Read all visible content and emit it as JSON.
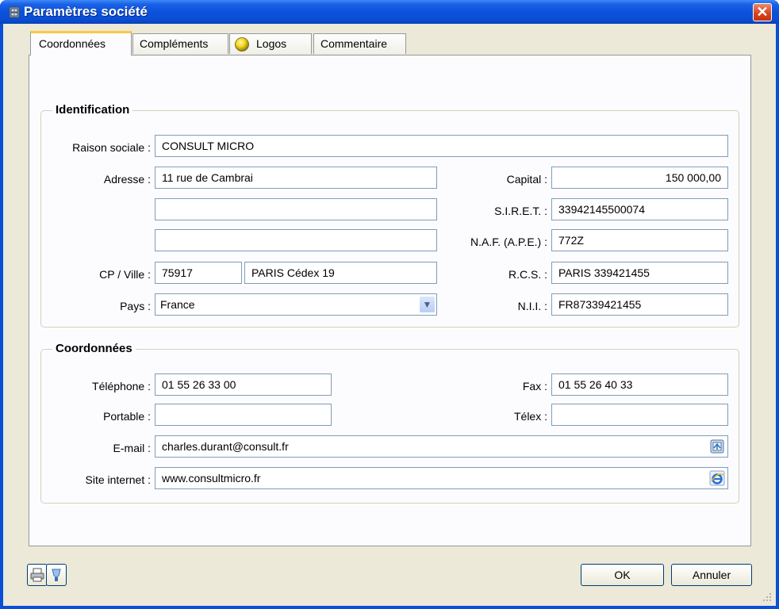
{
  "window": {
    "title": "Paramètres société",
    "icon": "app-cabinet-icon",
    "close_icon": "close-icon"
  },
  "tabs": [
    {
      "label": "Coordonnées",
      "active": true
    },
    {
      "label": "Compléments",
      "active": false
    },
    {
      "label": "Logos",
      "icon": "logo-sphere-icon",
      "active": false
    },
    {
      "label": "Commentaire",
      "active": false
    }
  ],
  "identification": {
    "title": "Identification",
    "raison_sociale": {
      "label": "Raison sociale :",
      "value": "CONSULT MICRO"
    },
    "adresse": {
      "label": "Adresse :",
      "line1": "11 rue de Cambrai",
      "line2": "",
      "line3": ""
    },
    "cp_ville": {
      "label": "CP / Ville :",
      "cp": "75917",
      "ville": "PARIS Cédex 19"
    },
    "pays": {
      "label": "Pays :",
      "value": "France",
      "icon": "chevron-down-icon"
    },
    "capital": {
      "label": "Capital :",
      "value": "150 000,00"
    },
    "siret": {
      "label": "S.I.R.E.T. :",
      "value": "33942145500074"
    },
    "naf": {
      "label": "N.A.F. (A.P.E.) :",
      "value": "772Z"
    },
    "rcs": {
      "label": "R.C.S. :",
      "value": "PARIS 339421455"
    },
    "nii": {
      "label": "N.I.I. :",
      "value": "FR87339421455"
    }
  },
  "coordonnees": {
    "title": "Coordonnées",
    "telephone": {
      "label": "Téléphone :",
      "value": "01 55 26 33 00"
    },
    "portable": {
      "label": "Portable :",
      "value": ""
    },
    "fax": {
      "label": "Fax :",
      "value": "01 55 26 40 33"
    },
    "telex": {
      "label": "Télex :",
      "value": ""
    },
    "email": {
      "label": "E-mail :",
      "value": "charles.durant@consult.fr",
      "icon": "send-mail-icon"
    },
    "site": {
      "label": "Site internet :",
      "value": "www.consultmicro.fr",
      "icon": "internet-explorer-icon"
    }
  },
  "footer": {
    "left_icons": [
      "printer-icon",
      "help-icon"
    ],
    "ok_label": "OK",
    "cancel_label": "Annuler"
  }
}
